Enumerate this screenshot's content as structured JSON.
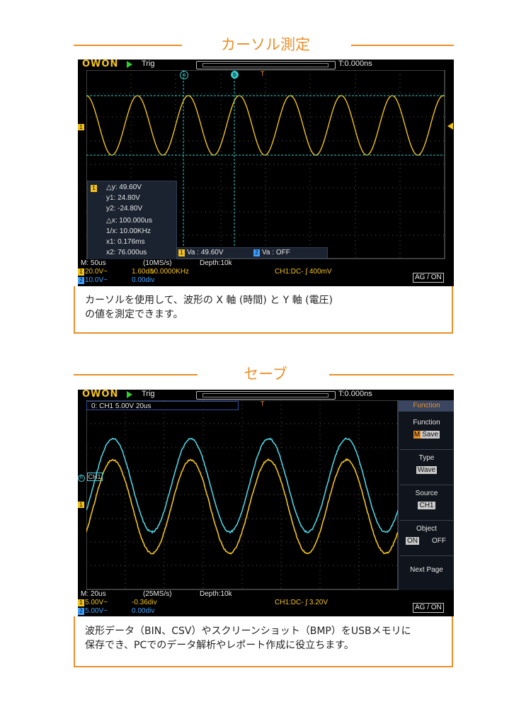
{
  "section1": {
    "title": "カーソル測定",
    "scope": {
      "logo": "OWON",
      "trig": "Trig",
      "time_offset": "T:0.000ns",
      "cursor_a": "a",
      "cursor_b": "b",
      "trig_marker": "T",
      "ch1_marker": "1",
      "panel": {
        "ch": "1",
        "dy": "△y: 49.60V",
        "y1": "y1: 24.80V",
        "y2": "y2: -24.80V",
        "dx": "△x: 100.000us",
        "inv": "1/x: 10.00KHz",
        "x1": "x1: 0.176ms",
        "x2": "x2: 76.000us"
      },
      "va1_tag": "1",
      "va1": "Va : 49.60V",
      "va2_tag": "2",
      "va2": "Va : OFF",
      "timebase": "M: 50us",
      "sample": "(10MS/s)",
      "depth": "Depth:10k",
      "ch1_tag": "1",
      "ch1_scale": "20.0V~",
      "ch1_div": "1.60div",
      "freq": "10.0000KHz",
      "trigger": "CH1:DC- ∫ 400mV",
      "ch2_tag": "2",
      "ch2_scale": "10.0V~",
      "ch2_div": "0.00div",
      "ag": "AG / ON"
    },
    "caption_line1": "カーソルを使用して、波形の X 軸 (時間) と Y 軸 (電圧)",
    "caption_line2": "の値を測定できます。"
  },
  "section2": {
    "title": "セーブ",
    "scope": {
      "logo": "OWON",
      "trig": "Trig",
      "time_offset": "T:0.000ns",
      "save_info": "0: CH1 5.00V 20us",
      "trig_marker": "T",
      "ch1_marker": "1",
      "ref_marker": "R",
      "ref_label": "CH1",
      "menu": {
        "title": "Function",
        "function_label": "Function",
        "function_prefix": "M",
        "function_value": "Save",
        "type_label": "Type",
        "type_value": "Wave",
        "source_label": "Source",
        "source_value": "CH1",
        "object_label": "Object",
        "object_on": "ON",
        "object_off": "OFF",
        "next_page": "Next Page"
      },
      "timebase": "M: 20us",
      "sample": "(25MS/s)",
      "depth": "Depth:10k",
      "ch1_tag": "1",
      "ch1_scale": "5.00V~",
      "ch1_div": "-0.36div",
      "trigger": "CH1:DC- ∫ 3.20V",
      "ch2_tag": "2",
      "ch2_scale": "5.00V~",
      "ch2_div": "0.00div",
      "ag": "AG / ON"
    },
    "caption_line1": "波形データ（BIN、CSV）やスクリーンショット（BMP）をUSBメモリに",
    "caption_line2": "保存でき、PCでのデータ解析やレポート作成に役立ちます。"
  },
  "colors": {
    "accent": "#e8902a",
    "ch1": "#f2c21b",
    "ch2": "#4fd0e0",
    "scope_bg": "#000000"
  }
}
